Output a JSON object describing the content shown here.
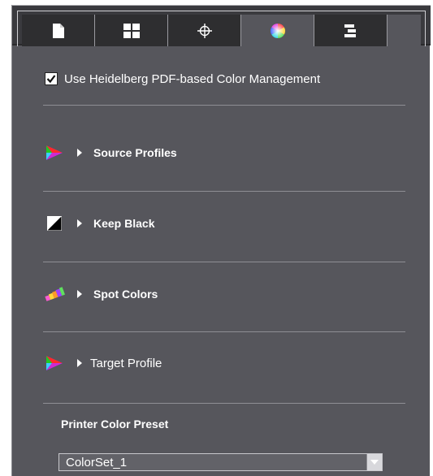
{
  "tabs": [
    {
      "icon": "document-icon",
      "label": ""
    },
    {
      "icon": "layout-grid-icon",
      "label": ""
    },
    {
      "icon": "crosshair-icon",
      "label": ""
    },
    {
      "icon": "color-wheel-icon",
      "label": "",
      "active": true
    },
    {
      "icon": "align-bars-icon",
      "label": ""
    }
  ],
  "color_management": {
    "checkbox_label": "Use Heidelberg PDF-based Color Management",
    "checked": true
  },
  "sections": [
    {
      "icon": "color-gamut-icon",
      "title": "Source Profiles"
    },
    {
      "icon": "keep-black-icon",
      "title": "Keep Black"
    },
    {
      "icon": "color-swatches-icon",
      "title": "Spot Colors"
    },
    {
      "icon": "color-gamut-icon",
      "title": "Target Profile"
    }
  ],
  "printer_preset": {
    "label": "Printer Color Preset",
    "value": "ColorSet_1"
  },
  "colors": {
    "panel_bg": "#56565c",
    "tab_bg": "#2e2e30",
    "text": "#ffffff"
  }
}
